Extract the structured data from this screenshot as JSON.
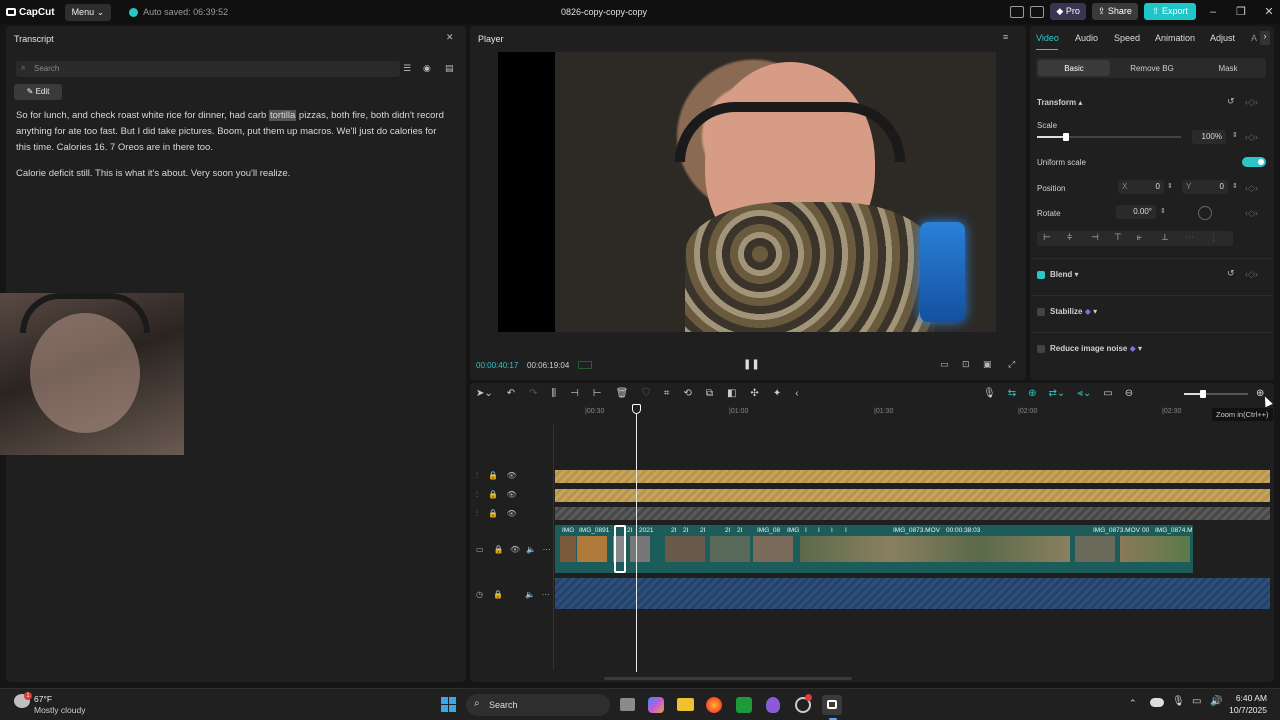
{
  "app": {
    "logo": "CapCut",
    "menu_label": "Menu",
    "autosave": "Auto saved: 06:39:52",
    "project_title": "0826-copy-copy-copy",
    "pro_label": "Pro",
    "share_label": "Share",
    "export_label": "Export"
  },
  "transcript": {
    "title": "Transcript",
    "search_placeholder": "Search",
    "edit_label": "Edit",
    "para1_before": "So for lunch, and check roast white rice for dinner, had carb ",
    "para1_highlight": "tortilla",
    "para1_after": " pizzas, both fire, both didn't record anything for ate too fast. But I did take pictures. Boom, put them up macros. We'll just do calories for this time. Calories 16. 7 Oreos are in there too.",
    "para2": "Calorie deficit still. This is what it's about. Very soon you'll realize."
  },
  "player": {
    "title": "Player",
    "current_time": "00:00:40:17",
    "total_time": "00:06:19:04"
  },
  "inspector": {
    "tabs": [
      "Video",
      "Audio",
      "Speed",
      "Animation",
      "Adjust",
      "A"
    ],
    "subtabs": [
      "Basic",
      "Remove BG",
      "Mask"
    ],
    "transform_label": "Transform",
    "scale_label": "Scale",
    "scale_value": "100%",
    "scale_level": 0.2,
    "uniform_scale_label": "Uniform scale",
    "position_label": "Position",
    "pos_x_label": "X",
    "pos_x": "0",
    "pos_y_label": "Y",
    "pos_y": "0",
    "rotate_label": "Rotate",
    "rotate_value": "0.00°",
    "blend_label": "Blend",
    "stabilize_label": "Stabilize",
    "noise_label": "Reduce image noise"
  },
  "timeline": {
    "ruler": [
      "|00:30",
      "|01:00",
      "|01:30",
      "|02:00",
      "|02:30"
    ],
    "tooltip": "Zoom in(Ctrl++)",
    "zoom_level": 0.3,
    "clip_labels": [
      "IMG",
      "IMG_0891",
      "2I",
      "2021",
      "2I",
      "2I",
      "2I",
      "2I",
      "2I",
      "IMG_08",
      "IMG",
      "I",
      "I",
      "I",
      "I",
      "IMG_0873.MOV",
      "00:00:38:03",
      "IMG_0873.MOV",
      "00",
      "IMG_0874.M"
    ]
  },
  "taskbar": {
    "weather_temp": "67°F",
    "weather_desc": "Mostly cloudy",
    "weather_badge": "1",
    "search_label": "Search",
    "time": "6:40 AM",
    "date": "10/7/2025"
  },
  "colors": {
    "accent": "#1fc6c9",
    "audio_gold": "#c7a45d",
    "video_track": "#1c5c5a",
    "audio_blue": "#2d4f7a"
  }
}
